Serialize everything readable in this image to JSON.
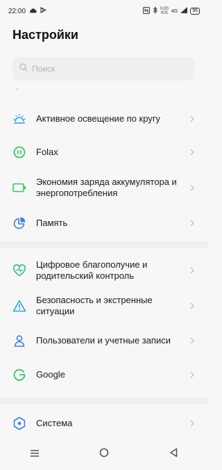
{
  "status_bar": {
    "time": "22:00",
    "net_speed_value": "0,00",
    "net_speed_unit": "K/S",
    "network_type": "4G",
    "battery_level": "96"
  },
  "header": {
    "title": "Настройки"
  },
  "search": {
    "placeholder": "Поиск"
  },
  "settings": [
    {
      "label": "Активное освещение по кругу",
      "icon": "light-icon",
      "color": "#2aa3e8"
    },
    {
      "label": "Folax",
      "icon": "folax-icon",
      "color": "#34c759"
    },
    {
      "label": "Экономия заряда аккумулятора и энергопотребления",
      "icon": "battery-icon",
      "color": "#34c759"
    },
    {
      "label": "Память",
      "icon": "storage-pie-icon",
      "color": "#3d7ee8"
    },
    {
      "label": "Цифровое благополучие и родительский контроль",
      "icon": "heart-icon",
      "color": "#2cbf7a"
    },
    {
      "label": "Безопасность и экстренные ситуации",
      "icon": "warning-icon",
      "color": "#2aa3e8"
    },
    {
      "label": "Пользователи и учетные записи",
      "icon": "user-icon",
      "color": "#3d7ee8"
    },
    {
      "label": "Google",
      "icon": "google-icon",
      "color": "#34c759"
    },
    {
      "label": "Система",
      "icon": "system-icon",
      "color": "#3d7ee8"
    }
  ]
}
